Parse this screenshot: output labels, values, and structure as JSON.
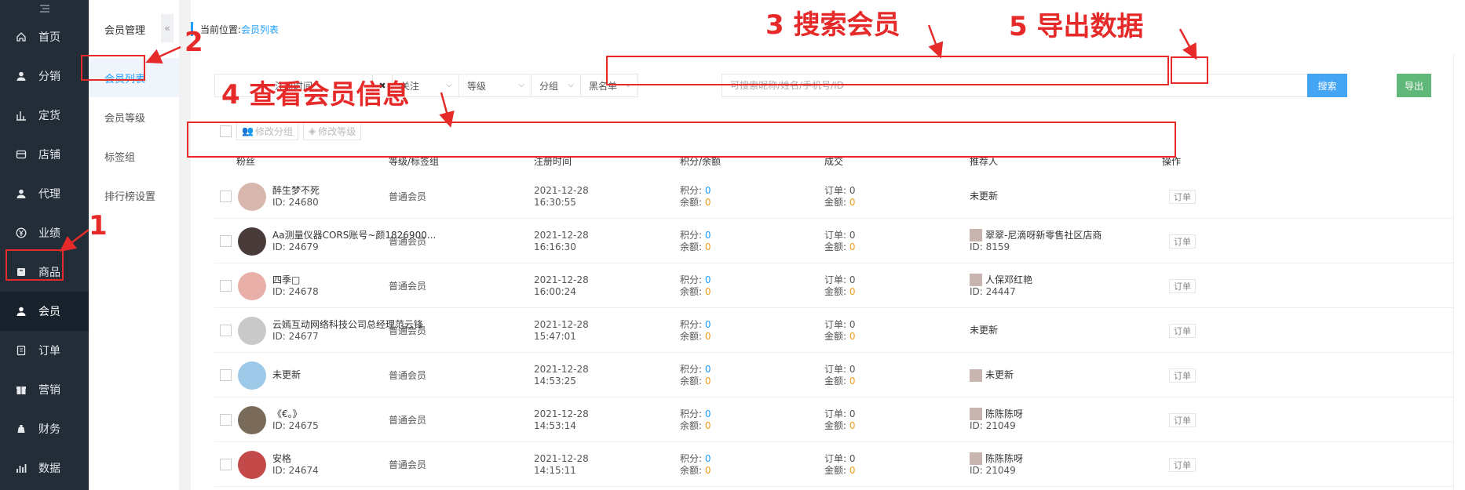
{
  "nav": {
    "top_icon": "menu-collapse-icon",
    "items": [
      {
        "label": "首页",
        "icon": "home-icon"
      },
      {
        "label": "分销",
        "icon": "user-icon"
      },
      {
        "label": "定货",
        "icon": "bar-chart-icon"
      },
      {
        "label": "店铺",
        "icon": "store-icon"
      },
      {
        "label": "代理",
        "icon": "agent-icon"
      },
      {
        "label": "业绩",
        "icon": "yen-icon"
      },
      {
        "label": "商品",
        "icon": "goods-icon"
      },
      {
        "label": "会员",
        "icon": "member-icon",
        "active": true
      },
      {
        "label": "订单",
        "icon": "order-icon"
      },
      {
        "label": "营销",
        "icon": "gift-icon"
      },
      {
        "label": "财务",
        "icon": "money-bag-icon"
      },
      {
        "label": "数据",
        "icon": "data-icon"
      }
    ]
  },
  "subnav": {
    "title": "会员管理",
    "collapse_glyph": "«",
    "items": [
      {
        "label": "会员列表",
        "active": true
      },
      {
        "label": "会员等级"
      },
      {
        "label": "标签组"
      },
      {
        "label": "排行榜设置"
      }
    ]
  },
  "breadcrumb": {
    "prefix": "当前位置:",
    "current": "会员列表"
  },
  "filters": {
    "register_time": "注册时间",
    "clear_glyph": "✖",
    "follow": "关注",
    "level": "等级",
    "group": "分组",
    "blacklist": "黑名单",
    "search_placeholder": "可搜索昵称/姓名/手机号/ID",
    "search_button": "搜索",
    "export_button": "导出"
  },
  "bulk": {
    "edit_group": "修改分组",
    "edit_level": "修改等级"
  },
  "table": {
    "headers": [
      "粉丝",
      "等级/标签组",
      "注册时间",
      "积分/余额",
      "成交",
      "推荐人",
      "操作"
    ],
    "points_label": "积分:",
    "balance_label": "余额:",
    "orders_label": "订单:",
    "amount_label": "金额:",
    "order_button": "订单",
    "rows": [
      {
        "name": "醉生梦不死",
        "id": "ID: 24680",
        "level": "普通会员",
        "date": "2021-12-28",
        "time": "16:30:55",
        "points": "0",
        "balance": "0",
        "orders": "0",
        "amount": "0",
        "ref_name": "未更新",
        "ref_id": ""
      },
      {
        "name": "Aa测量仪器CORS账号~颜1826900...",
        "id": "ID: 24679",
        "level": "普通会员",
        "date": "2021-12-28",
        "time": "16:16:30",
        "points": "0",
        "balance": "0",
        "orders": "0",
        "amount": "0",
        "ref_name": "翠翠-尼滴呀新零售社区店商",
        "ref_id": "ID: 8159"
      },
      {
        "name": "四季□",
        "id": "ID: 24678",
        "level": "普通会员",
        "date": "2021-12-28",
        "time": "16:00:24",
        "points": "0",
        "balance": "0",
        "orders": "0",
        "amount": "0",
        "ref_name": "人保邓红艳",
        "ref_id": "ID: 24447"
      },
      {
        "name": "云嫣互动网络科技公司总经理范云锋",
        "id": "ID: 24677",
        "level": "普通会员",
        "date": "2021-12-28",
        "time": "15:47:01",
        "points": "0",
        "balance": "0",
        "orders": "0",
        "amount": "0",
        "ref_name": "未更新",
        "ref_id": ""
      },
      {
        "name": "未更新",
        "id": "",
        "level": "普通会员",
        "date": "2021-12-28",
        "time": "14:53:25",
        "points": "0",
        "balance": "0",
        "orders": "0",
        "amount": "0",
        "ref_name": "未更新",
        "ref_id": ""
      },
      {
        "name": "《€。》",
        "id": "ID: 24675",
        "level": "普通会员",
        "date": "2021-12-28",
        "time": "14:53:14",
        "points": "0",
        "balance": "0",
        "orders": "0",
        "amount": "0",
        "ref_name": "陈陈陈呀",
        "ref_id": "ID: 21049"
      },
      {
        "name": "安格",
        "id": "ID: 24674",
        "level": "普通会员",
        "date": "2021-12-28",
        "time": "14:15:11",
        "points": "0",
        "balance": "0",
        "orders": "0",
        "amount": "0",
        "ref_name": "陈陈陈呀",
        "ref_id": "ID: 21049"
      }
    ]
  },
  "annotations": {
    "step1": "1",
    "step2": "2",
    "step3": "3 搜索会员",
    "step4": "4 查看会员信息",
    "step5": "5  导出数据"
  },
  "colors": {
    "annotation": "#e62a2a",
    "nav_bg": "#222d38",
    "link": "#1e9fff",
    "search_button": "#44a5f5",
    "export_button": "#5fb878",
    "amount": "#f0a020"
  }
}
